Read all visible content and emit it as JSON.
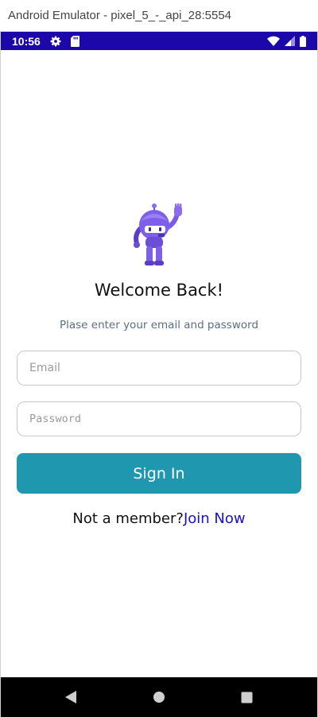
{
  "emulator": {
    "title": "Android Emulator - pixel_5_-_api_28:5554"
  },
  "status_bar": {
    "time": "10:56",
    "icons": [
      "settings-gear-icon",
      "sd-card-icon",
      "wifi-icon",
      "cell-signal-icon",
      "battery-icon"
    ],
    "background": "#1c08a8"
  },
  "login": {
    "mascot_icon": "waving-robot-mascot",
    "title": "Welcome Back!",
    "subtitle": "Plase enter your email and password",
    "email_placeholder": "Email",
    "email_value": "",
    "password_placeholder": "Password",
    "password_value": "",
    "sign_in_label": "Sign In",
    "sign_in_color": "#1f97af",
    "prompt_text": "Not a member?",
    "join_link": "Join Now",
    "join_link_color": "#1a0fd6"
  },
  "nav_bar": {
    "buttons": [
      "back-triangle-icon",
      "home-circle-icon",
      "recents-square-icon"
    ]
  }
}
